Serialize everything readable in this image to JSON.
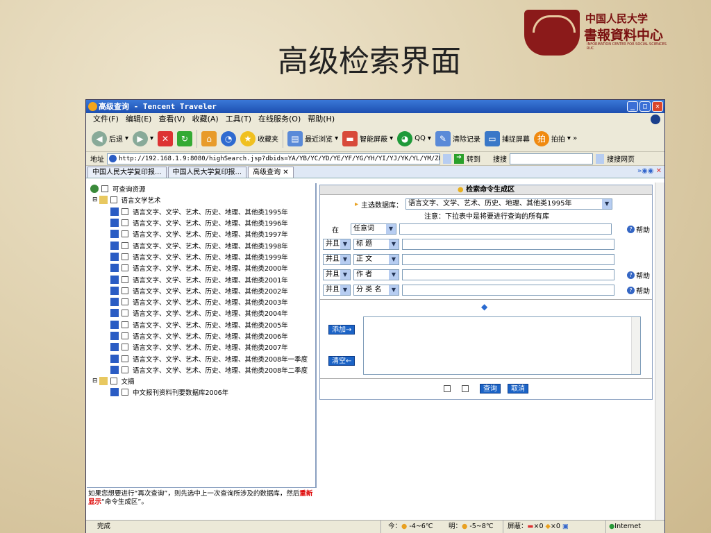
{
  "slide": {
    "title": "高级检索界面"
  },
  "logo": {
    "cn1": "中国人民大学",
    "cn2": "書報資料中心",
    "en": "INFORMATION CENTER FOR SOCIAL SCIENCES RUC"
  },
  "window": {
    "title": "高级查询 - Tencent Traveler"
  },
  "menu": [
    "文件(F)",
    "编辑(E)",
    "查看(V)",
    "收藏(A)",
    "工具(T)",
    "在线服务(O)",
    "帮助(H)"
  ],
  "toolbar": {
    "back": "后退",
    "favorites": "收藏夹",
    "recent": "最近浏览",
    "smart": "智能屏蔽",
    "qq": "QQ",
    "clear": "清除记录",
    "capture": "捕捉屏幕",
    "photo": "拍拍"
  },
  "address": {
    "label": "地址",
    "url": "http://192.168.1.9:8080/highSearch.jsp?dbids=YA/YB/YC/YD/YE/YF/YG/YH/YI/YJ/YK/YL/YM/ZD/ZI/W6#",
    "go": "转到",
    "search_label": "搜搜",
    "search_btn": "搜搜网页"
  },
  "tabs": [
    "中国人民大学复印报...",
    "中国人民大学复印报...",
    "高级查询"
  ],
  "tree": {
    "root": "可查询资源",
    "group1": "语言文学艺术",
    "items": [
      "语言文字、文学、艺术、历史、地理、其他类1995年",
      "语言文字、文学、艺术、历史、地理、其他类1996年",
      "语言文字、文学、艺术、历史、地理、其他类1997年",
      "语言文字、文学、艺术、历史、地理、其他类1998年",
      "语言文字、文学、艺术、历史、地理、其他类1999年",
      "语言文字、文学、艺术、历史、地理、其他类2000年",
      "语言文字、文学、艺术、历史、地理、其他类2001年",
      "语言文字、文学、艺术、历史、地理、其他类2002年",
      "语言文字、文学、艺术、历史、地理、其他类2003年",
      "语言文字、文学、艺术、历史、地理、其他类2004年",
      "语言文字、文学、艺术、历史、地理、其他类2005年",
      "语言文字、文学、艺术、历史、地理、其他类2006年",
      "语言文字、文学、艺术、历史、地理、其他类2007年",
      "语言文字、文学、艺术、历史、地理、其他类2008年一季度",
      "语言文字、文学、艺术、历史、地理、其他类2008年二季度"
    ],
    "group2": "文摘",
    "group2_item": "中文报刊资料刊要数据库2006年"
  },
  "note": {
    "text1": "如果您想要进行“再次查询”，则先选中上一次查询所涉及的数据库，然后",
    "highlight": "重新显示",
    "text2": "“命令生成区”。"
  },
  "panel": {
    "header": "检索命令生成区",
    "db_label": "主选数据库：",
    "db_value": "语言文字、文学、艺术、历史、地理、其他类1995年",
    "notice": "注意：下拉表中是将要进行查询的所有库",
    "rows": [
      {
        "op": "在",
        "field": "任意词",
        "help": "帮助"
      },
      {
        "op": "并且",
        "field": "标 题",
        "help": ""
      },
      {
        "op": "并且",
        "field": "正 文",
        "help": ""
      },
      {
        "op": "并且",
        "field": "作 者",
        "help": "帮助"
      },
      {
        "op": "并且",
        "field": "分 类 名",
        "help": "帮助"
      }
    ],
    "add_btn": "添加→",
    "clear_btn": "清空←",
    "search_btn": "查询",
    "cancel_btn": "取消"
  },
  "status": {
    "left": "完成",
    "weather1": "今：",
    "temp1": "-4~6℃",
    "weather2": "明：",
    "temp2": "-5~8℃",
    "block": "屏蔽：",
    "x1": "×0",
    "x2": "×0",
    "zone": "Internet"
  }
}
